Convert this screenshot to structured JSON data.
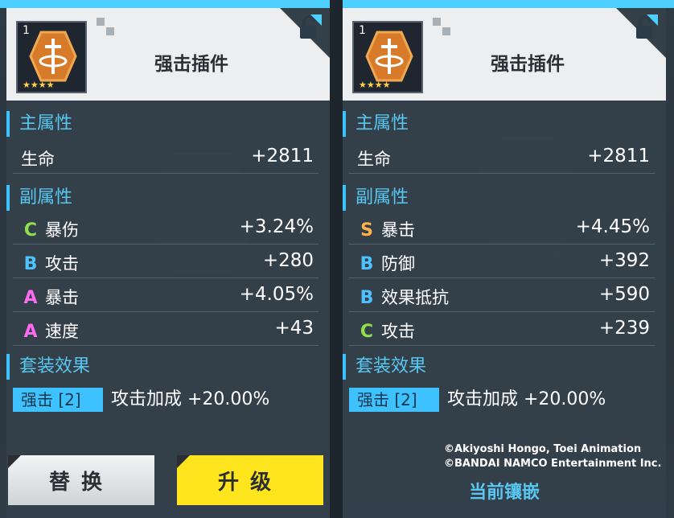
{
  "colors": {
    "accent": "#3ec1ff",
    "section_title": "#58c8f2",
    "grade_S": "#ffb24a",
    "grade_A": "#ff6bf0",
    "grade_B": "#4ec1ff",
    "grade_C": "#8fe04a",
    "upgrade_button": "#ffe51e"
  },
  "left_card": {
    "item": {
      "level": "1",
      "name": "强击插件",
      "stars": "★★★★",
      "icon": "chip-hex-icon"
    },
    "main_title": "主属性",
    "main_stat": {
      "label": "生命",
      "value": "+2811"
    },
    "sub_title": "副属性",
    "sub_stats": [
      {
        "grade": "C",
        "label": "暴伤",
        "value": "+3.24%"
      },
      {
        "grade": "B",
        "label": "攻击",
        "value": "+280"
      },
      {
        "grade": "A",
        "label": "暴击",
        "value": "+4.05%"
      },
      {
        "grade": "A",
        "label": "速度",
        "value": "+43"
      }
    ],
    "set_title": "套装效果",
    "set_tag": "强击",
    "set_count": "[2]",
    "set_desc": "攻击加成  +20.00%",
    "buttons": {
      "replace": "替换",
      "upgrade": "升级"
    }
  },
  "right_card": {
    "item": {
      "level": "1",
      "name": "强击插件",
      "stars": "★★★★",
      "icon": "chip-hex-icon"
    },
    "main_title": "主属性",
    "main_stat": {
      "label": "生命",
      "value": "+2811"
    },
    "sub_title": "副属性",
    "sub_stats": [
      {
        "grade": "S",
        "label": "暴击",
        "value": "+4.45%"
      },
      {
        "grade": "B",
        "label": "防御",
        "value": "+392"
      },
      {
        "grade": "B",
        "label": "效果抵抗",
        "value": "+590"
      },
      {
        "grade": "C",
        "label": "攻击",
        "value": "+239"
      }
    ],
    "set_title": "套装效果",
    "set_tag": "强击",
    "set_count": "[2]",
    "set_desc": "攻击加成  +20.00%",
    "current_label": "当前镶嵌"
  },
  "copyright": {
    "line1": "©Akiyoshi Hongo, Toei Animation",
    "line2": "©BANDAI NAMCO Entertainment Inc."
  }
}
